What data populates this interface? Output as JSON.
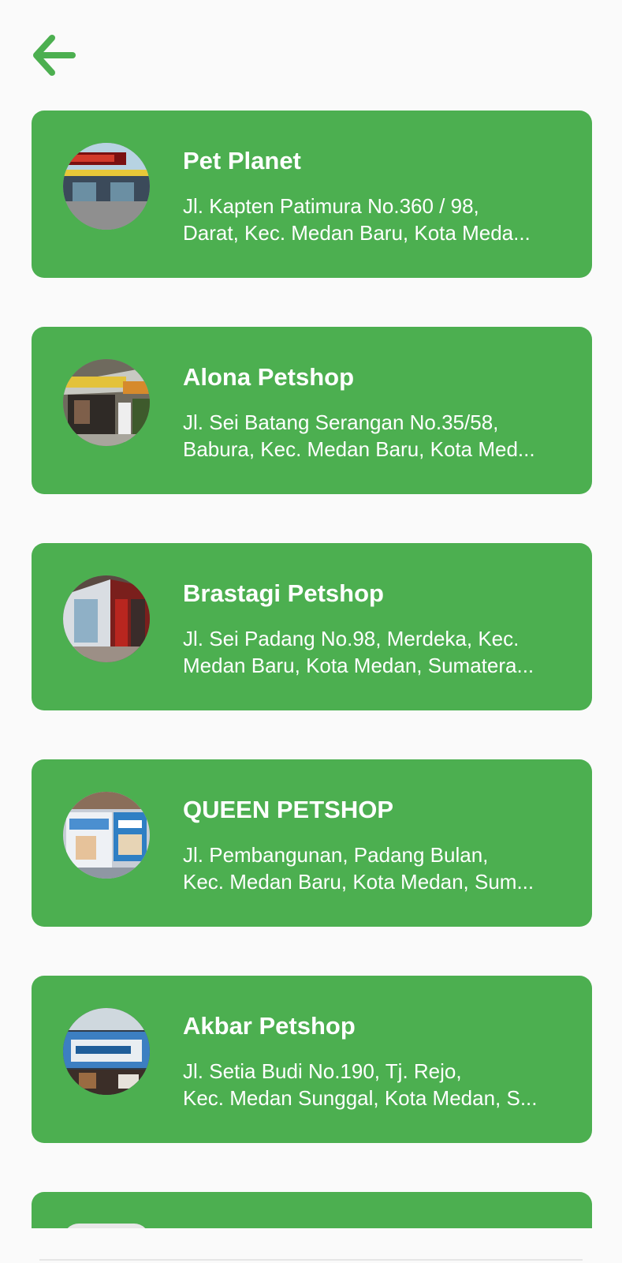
{
  "header": {
    "back_icon": "arrow-left-icon",
    "accent_color": "#4caf50"
  },
  "shops": [
    {
      "name": "Pet Planet",
      "address_line1": "Jl. Kapten Patimura No.360 / 98,",
      "address_line2": "Darat, Kec. Medan Baru, Kota Meda..."
    },
    {
      "name": "Alona Petshop",
      "address_line1": "Jl. Sei Batang Serangan No.35/58,",
      "address_line2": "Babura, Kec. Medan Baru, Kota Med..."
    },
    {
      "name": "Brastagi Petshop",
      "address_line1": "Jl. Sei Padang No.98, Merdeka, Kec.",
      "address_line2": "Medan Baru, Kota Medan, Sumatera..."
    },
    {
      "name": "QUEEN PETSHOP",
      "address_line1": "Jl. Pembangunan, Padang Bulan,",
      "address_line2": "Kec. Medan Baru, Kota Medan, Sum..."
    },
    {
      "name": "Akbar Petshop",
      "address_line1": "Jl. Setia Budi No.190, Tj. Rejo,",
      "address_line2": "Kec. Medan Sunggal, Kota Medan, S..."
    }
  ],
  "colors": {
    "card_bg": "#4caf50",
    "page_bg": "#fafafa",
    "text": "#ffffff"
  }
}
